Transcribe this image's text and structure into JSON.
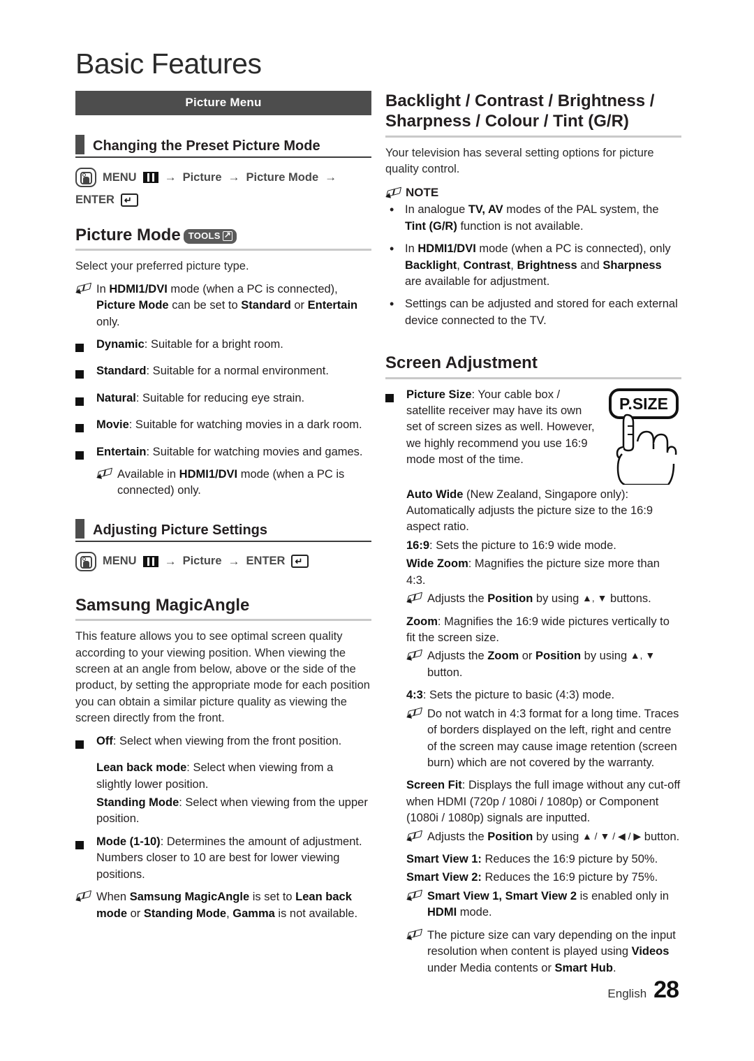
{
  "page": {
    "title": "Basic Features",
    "footer_language": "English",
    "footer_page_number": "28"
  },
  "left": {
    "banner": "Picture Menu",
    "subhead_1": "Changing the Preset Picture Mode",
    "menupath_1": {
      "menu": "MENU",
      "arrow": "→",
      "step_picture": "Picture",
      "step_picture_mode": "Picture Mode",
      "enter": "ENTER"
    },
    "picture_mode_heading": "Picture Mode",
    "tools_badge": "TOOLS",
    "picture_mode_intro": "Select your preferred picture type.",
    "hdmi_note": {
      "t1": "In ",
      "b1": "HDMI1/DVI",
      "t2": " mode (when a PC is connected), ",
      "b2": "Picture Mode",
      "t3": " can be set to ",
      "b3": "Standard",
      "t4": " or ",
      "b4": "Entertain",
      "t5": " only."
    },
    "modes": [
      {
        "name": "Dynamic",
        "desc": ": Suitable for a bright room."
      },
      {
        "name": "Standard",
        "desc": ": Suitable for a normal environment."
      },
      {
        "name": "Natural",
        "desc": ": Suitable for reducing eye strain."
      },
      {
        "name": "Movie",
        "desc": ": Suitable for watching movies in a dark room."
      },
      {
        "name": "Entertain",
        "desc": ": Suitable for watching movies and games."
      }
    ],
    "entertain_note": {
      "t1": "Available in ",
      "b1": "HDMI1/DVI",
      "t2": " mode (when a PC is connected) only."
    },
    "subhead_2": "Adjusting Picture Settings",
    "menupath_2": {
      "menu": "MENU",
      "arrow": "→",
      "step_picture": "Picture",
      "enter": "ENTER"
    },
    "magicangle_heading": "Samsung MagicAngle",
    "magicangle_para": "This feature allows you to see optimal screen quality according to your viewing position. When viewing the screen at an angle from below, above or the side of the product, by setting the appropriate mode for each position you can obtain a similar picture quality as viewing the screen directly from the front.",
    "off_item": {
      "name": "Off",
      "desc": ": Select when viewing from the front position."
    },
    "lean_back": {
      "name": "Lean back mode",
      "desc": ": Select when viewing from a slightly lower position."
    },
    "standing": {
      "name": "Standing Mode",
      "desc": ": Select when viewing from the upper position."
    },
    "mode_1_10": {
      "name": "Mode (1-10)",
      "desc": ": Determines the amount of adjustment. Numbers closer to 10 are best for lower viewing positions."
    },
    "gamma_note": {
      "t1": "When ",
      "b1": "Samsung MagicAngle",
      "t2": " is set to ",
      "b2": "Lean back mode",
      "t3": " or ",
      "b3": "Standing Mode",
      "t4": ", ",
      "b4": "Gamma",
      "t5": " is not available."
    }
  },
  "right": {
    "backlight_heading_line1": "Backlight / Contrast / Brightness /",
    "backlight_heading_line2": "Sharpness / Colour / Tint (G/R)",
    "backlight_intro": "Your television has several setting options for picture quality control.",
    "note_label": "NOTE",
    "notes": [
      {
        "t1": "In analogue ",
        "b1": "TV, AV",
        "t2": " modes of the PAL system, the ",
        "b2": "Tint (G/R)",
        "t3": " function is not available.",
        "b3": "",
        "t4": ""
      },
      {
        "t1": "In ",
        "b1": "HDMI1/DVI",
        "t2": " mode (when a PC is connected), only ",
        "b2": "Backlight",
        "t3": ", ",
        "b3": "Contrast",
        "t4": ", ",
        "b4": "Brightness",
        "t5": " and ",
        "b5": "Sharpness",
        "t6": " are available for adjustment."
      },
      {
        "t1": "Settings can be adjusted and stored for each external device connected to the TV.",
        "b1": "",
        "t2": ""
      }
    ],
    "screen_adjustment_heading": "Screen Adjustment",
    "picture_size": {
      "name": "Picture Size",
      "desc": ": Your cable box / satellite receiver may have its own set of screen sizes as well. However, we highly recommend you use 16:9 mode most of the time.",
      "button_label": "P.SIZE"
    },
    "auto_wide": {
      "name": "Auto Wide",
      "desc": " (New Zealand, Singapore only): Automatically adjusts the picture size to the 16:9 aspect ratio."
    },
    "ratio_169": {
      "name": "16:9",
      "desc": ": Sets the picture to 16:9 wide mode."
    },
    "wide_zoom": {
      "name": "Wide Zoom",
      "desc": ": Magnifies the picture size more than 4:3."
    },
    "wide_zoom_note": {
      "t1": "Adjusts the ",
      "b1": "Position",
      "t2": " by using ",
      "arrows": "▲, ▼",
      "t3": " buttons."
    },
    "zoom": {
      "name": "Zoom",
      "desc": ": Magnifies the 16:9 wide pictures vertically to fit the screen size."
    },
    "zoom_note": {
      "t1": "Adjusts the ",
      "b1": "Zoom",
      "t2": " or ",
      "b2": "Position",
      "t3": " by using ",
      "arrows": "▲, ▼",
      "t4": " button."
    },
    "ratio_43": {
      "name": "4:3",
      "desc": ": Sets the picture to basic (4:3) mode."
    },
    "ratio_43_note": "Do not watch in 4:3 format for a long time. Traces of borders displayed on the left, right and centre of the screen may cause image retention (screen burn) which are not covered by the warranty.",
    "screen_fit": {
      "name": "Screen Fit",
      "desc": ": Displays the full image without any cut-off when HDMI (720p / 1080i / 1080p) or Component (1080i / 1080p) signals are inputted."
    },
    "screen_fit_note": {
      "t1": "Adjusts the ",
      "b1": "Position",
      "t2": " by using ",
      "arrows": "▲ / ▼ / ◀ / ▶",
      "t3": " button."
    },
    "smart_view_1": {
      "name": "Smart View 1:",
      "desc": " Reduces the 16:9 picture by 50%."
    },
    "smart_view_2": {
      "name": "Smart View 2:",
      "desc": " Reduces the 16:9 picture by 75%."
    },
    "smart_view_note": {
      "b1": "Smart View 1, Smart View 2",
      "t1": " is enabled only in ",
      "b2": "HDMI",
      "t2": " mode."
    },
    "picture_size_note": {
      "t1": "The picture size can vary depending on the input resolution when content is played using ",
      "b1": "Videos",
      "t2": " under Media contents or ",
      "b2": "Smart Hub",
      "t3": "."
    }
  },
  "colors": {
    "banner_bg": "#4d4d4d",
    "marker": "#4d4d4d",
    "rule": "#c9c9c9",
    "text": "#231f20"
  }
}
